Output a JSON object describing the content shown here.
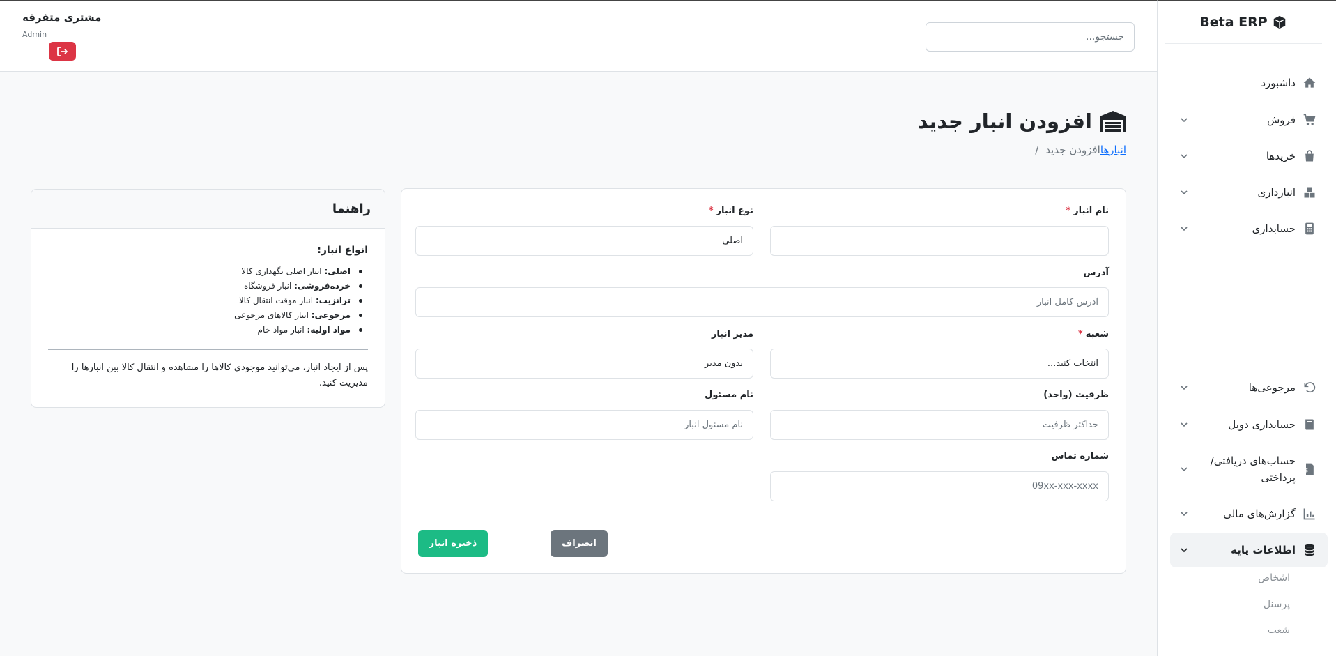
{
  "sidebar": {
    "brand": "Beta ERP",
    "items": [
      {
        "label": "داشبورد",
        "icon": "home-icon"
      },
      {
        "label": "فروش",
        "icon": "cart-icon"
      },
      {
        "label": "خریدها",
        "icon": "bag-icon"
      },
      {
        "label": "انبارداری",
        "icon": "boxes-icon"
      },
      {
        "label": "حسابداری",
        "icon": "calculator-icon"
      },
      {
        "label": "مرجوعی‌ها",
        "icon": "undo-icon"
      },
      {
        "label": "حسابداری دوبل",
        "icon": "book-icon"
      },
      {
        "label": "حساب‌های دریافتی/ پرداختی",
        "icon": "invoice-icon"
      },
      {
        "label": "گزارش‌های مالی",
        "icon": "chart-icon"
      },
      {
        "label": "اطلاعات پایه",
        "icon": "database-icon"
      }
    ],
    "subitems": [
      "اشخاص",
      "پرسنل",
      "شعب"
    ]
  },
  "header": {
    "search_placeholder": "جستجو...",
    "user_name": "مشتری متفرقه",
    "user_role": "Admin"
  },
  "page": {
    "title": "افزودن انبار جدید",
    "breadcrumb": {
      "link": "انبارها",
      "current": "افزودن جدید",
      "separator": "/"
    }
  },
  "form": {
    "name_label": "نام انبار",
    "type_label": "نوع انبار",
    "type_value": "اصلی",
    "address_label": "آدرس",
    "address_placeholder": "آدرس کامل انبار",
    "branch_label": "شعبه",
    "branch_value": "انتخاب کنید...",
    "manager_label": "مدیر انبار",
    "manager_value": "بدون مدیر",
    "capacity_label": "ظرفیت (واحد)",
    "capacity_placeholder": "حداکثر ظرفیت",
    "responsible_label": "نام مسئول",
    "responsible_placeholder": "نام مسئول انبار",
    "phone_label": "شماره تماس",
    "phone_placeholder": "09xx-xxx-xxxx",
    "required_mark": "*",
    "cancel_label": "انصراف",
    "save_label": "ذخیره انبار"
  },
  "help": {
    "title": "راهنما",
    "subtitle": "انواع انبار:",
    "types": [
      {
        "term": "اصلی:",
        "desc": "انبار اصلی نگهداری کالا"
      },
      {
        "term": "خرده‌فروشی:",
        "desc": "انبار فروشگاه"
      },
      {
        "term": "ترانزیت:",
        "desc": "انبار موقت انتقال کالا"
      },
      {
        "term": "مرجوعی:",
        "desc": "انبار کالاهای مرجوعی"
      },
      {
        "term": "مواد اولیه:",
        "desc": "انبار مواد خام"
      }
    ],
    "note": "پس از ایجاد انبار، می‌توانید موجودی کالاها را مشاهده و انتقال کالا بین انبارها را مدیریت کنید."
  },
  "colors": {
    "danger": "#dc3545",
    "save": "#1cbb85",
    "cancel": "#6c757d",
    "link": "#0d6efd"
  }
}
